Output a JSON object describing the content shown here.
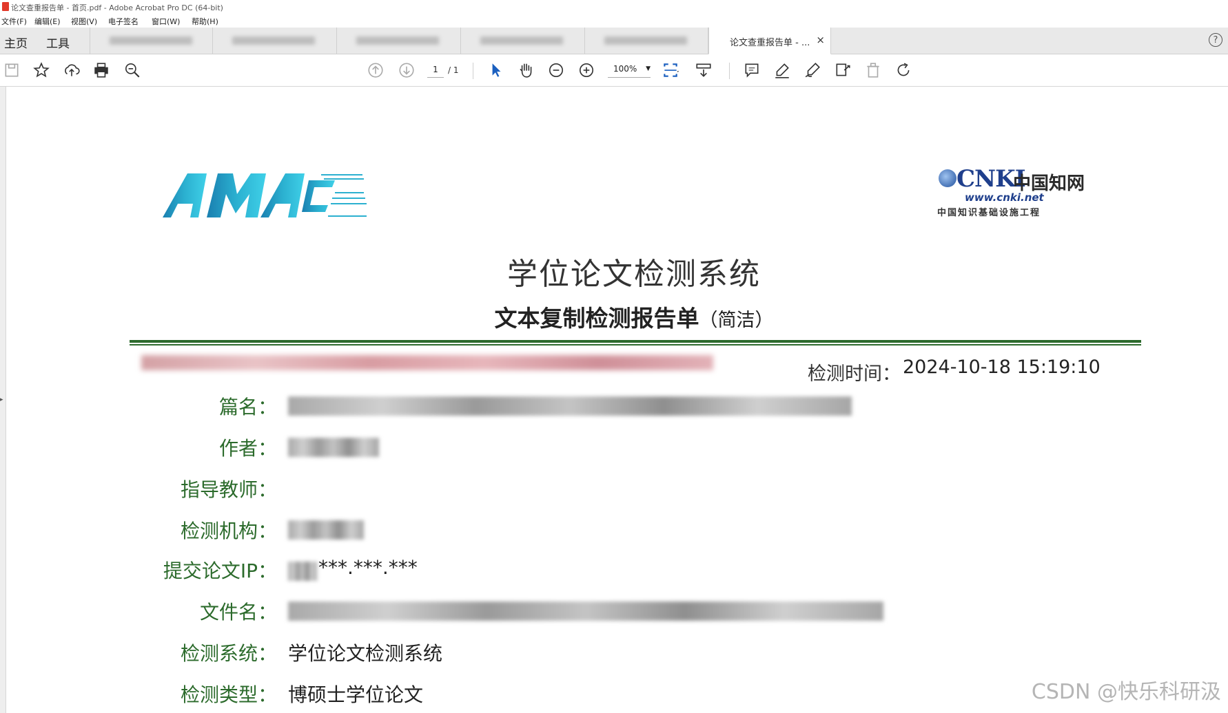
{
  "window": {
    "title": "论文查重报告单 - 首页.pdf - Adobe Acrobat Pro DC (64-bit)"
  },
  "menu": [
    "文件(F)",
    "编辑(E)",
    "视图(V)",
    "电子签名",
    "窗口(W)",
    "帮助(H)"
  ],
  "tabs": {
    "home": "主页",
    "tools": "工具",
    "active_doc": "论文查重报告单 - ...",
    "close": "×",
    "help": "?"
  },
  "toolbar": {
    "page_current": "1",
    "page_total": "/ 1",
    "zoom": "100%"
  },
  "document": {
    "cnki_logo": {
      "main": "CNKI",
      "chinese": "中国知网",
      "url": "www.cnki.net",
      "sub": "中国知识基础设施工程"
    },
    "title": "学位论文检测系统",
    "subtitle": "文本复制检测报告单",
    "subtitle_suffix": "（简洁）",
    "detect_time_label": "检测时间：",
    "detect_time_value": "2024-10-18 15:19:10",
    "fields": [
      {
        "label": "篇名：",
        "value": ""
      },
      {
        "label": "作者：",
        "value": ""
      },
      {
        "label": "指导教师：",
        "value": ""
      },
      {
        "label": "检测机构：",
        "value": ""
      },
      {
        "label": "提交论文IP：",
        "value": "***.***.***"
      },
      {
        "label": "文件名：",
        "value": ""
      },
      {
        "label": "检测系统：",
        "value": "学位论文检测系统"
      },
      {
        "label": "检测类型：",
        "value": "博硕士学位论文"
      }
    ]
  },
  "watermark": "CSDN @快乐科研汲"
}
